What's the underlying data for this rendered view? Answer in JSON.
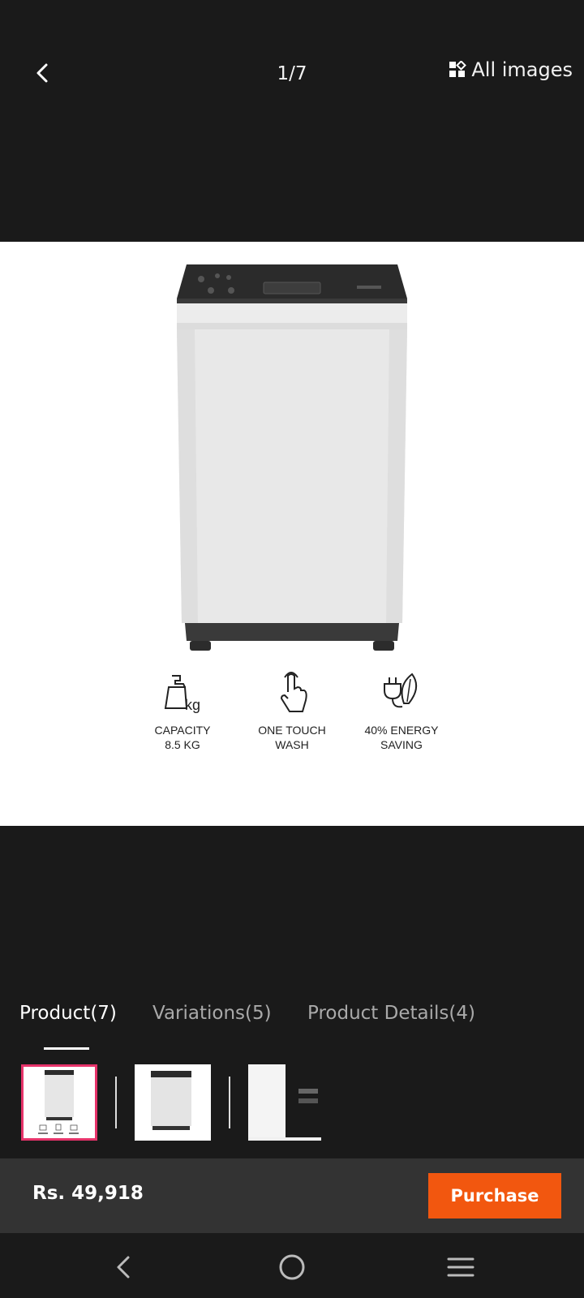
{
  "header": {
    "counter": "1/7",
    "all_images_label": "All images"
  },
  "features": [
    {
      "icon": "weight-kg-icon",
      "label": "CAPACITY\n8.5 KG"
    },
    {
      "icon": "touch-hand-icon",
      "label": "ONE TOUCH\nWASH"
    },
    {
      "icon": "plug-leaf-icon",
      "label": "40% ENERGY\nSAVING"
    }
  ],
  "tabs": [
    {
      "label": "Product(7)",
      "active": true
    },
    {
      "label": "Variations(5)",
      "active": false
    },
    {
      "label": "Product Details(4)",
      "active": false
    }
  ],
  "footer": {
    "price": "Rs. 49,918",
    "purchase_label": "Purchase"
  },
  "colors": {
    "background": "#1a1a1a",
    "accent": "#f2570f",
    "thumb_selected_border": "#e6336a"
  }
}
